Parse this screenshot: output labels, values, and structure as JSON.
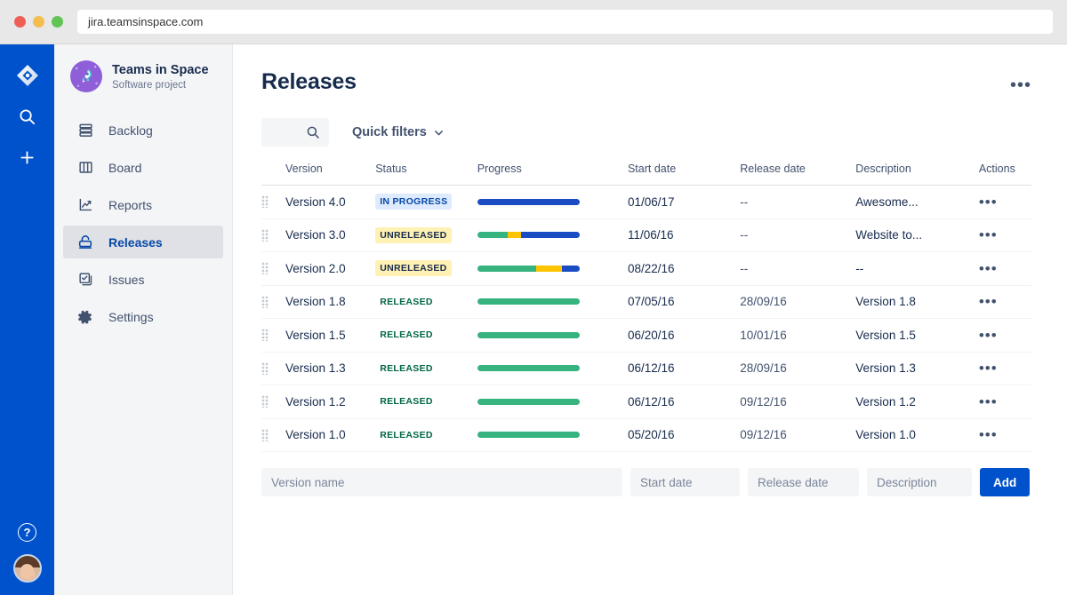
{
  "browser": {
    "url": "jira.teamsinspace.com"
  },
  "rail": {
    "logo_icon": "jira-logo-icon",
    "search_icon": "search-icon",
    "add_icon": "plus-icon",
    "help_label": "?",
    "avatar_label": "user-avatar"
  },
  "sidebar": {
    "project_name": "Teams in Space",
    "project_type": "Software project",
    "project_icon": "rocket-icon",
    "items": [
      {
        "label": "Backlog",
        "icon": "backlog-icon",
        "active": false
      },
      {
        "label": "Board",
        "icon": "board-icon",
        "active": false
      },
      {
        "label": "Reports",
        "icon": "reports-icon",
        "active": false
      },
      {
        "label": "Releases",
        "icon": "releases-icon",
        "active": true
      },
      {
        "label": "Issues",
        "icon": "issues-icon",
        "active": false
      },
      {
        "label": "Settings",
        "icon": "settings-icon",
        "active": false
      }
    ]
  },
  "header": {
    "title": "Releases",
    "more_label": "•••"
  },
  "toolbar": {
    "search_placeholder": "",
    "search_icon": "search-icon",
    "quick_filters_label": "Quick filters",
    "chevron_icon": "chevron-down-icon"
  },
  "table": {
    "columns": [
      "Version",
      "Status",
      "Progress",
      "Start date",
      "Release date",
      "Description",
      "Actions"
    ],
    "rows": [
      {
        "version": "Version 4.0",
        "status": "IN PROGRESS",
        "status_kind": "inprogress",
        "progress": {
          "done": 0,
          "in_progress": 0,
          "todo": 100
        },
        "start_date": "01/06/17",
        "release_date": "--",
        "description": "Awesome...",
        "actions_label": "•••"
      },
      {
        "version": "Version 3.0",
        "status": "UNRELEASED",
        "status_kind": "unreleased",
        "progress": {
          "done": 30,
          "in_progress": 13,
          "todo": 57
        },
        "start_date": "11/06/16",
        "release_date": "--",
        "description": "Website to...",
        "actions_label": "•••"
      },
      {
        "version": "Version 2.0",
        "status": "UNRELEASED",
        "status_kind": "unreleased",
        "progress": {
          "done": 58,
          "in_progress": 25,
          "todo": 17
        },
        "start_date": "08/22/16",
        "release_date": "--",
        "description": "--",
        "actions_label": "•••"
      },
      {
        "version": "Version 1.8",
        "status": "RELEASED",
        "status_kind": "released",
        "progress": {
          "done": 100,
          "in_progress": 0,
          "todo": 0
        },
        "start_date": "07/05/16",
        "release_date": "28/09/16",
        "description": "Version 1.8",
        "actions_label": "•••"
      },
      {
        "version": "Version 1.5",
        "status": "RELEASED",
        "status_kind": "released",
        "progress": {
          "done": 100,
          "in_progress": 0,
          "todo": 0
        },
        "start_date": "06/20/16",
        "release_date": "10/01/16",
        "description": "Version 1.5",
        "actions_label": "•••"
      },
      {
        "version": "Version 1.3",
        "status": "RELEASED",
        "status_kind": "released",
        "progress": {
          "done": 100,
          "in_progress": 0,
          "todo": 0
        },
        "start_date": "06/12/16",
        "release_date": "28/09/16",
        "description": "Version 1.3",
        "actions_label": "•••"
      },
      {
        "version": "Version 1.2",
        "status": "RELEASED",
        "status_kind": "released",
        "progress": {
          "done": 100,
          "in_progress": 0,
          "todo": 0
        },
        "start_date": "06/12/16",
        "release_date": "09/12/16",
        "description": "Version 1.2",
        "actions_label": "•••"
      },
      {
        "version": "Version 1.0",
        "status": "RELEASED",
        "status_kind": "released",
        "progress": {
          "done": 100,
          "in_progress": 0,
          "todo": 0
        },
        "start_date": "05/20/16",
        "release_date": "09/12/16",
        "description": "Version 1.0",
        "actions_label": "•••"
      }
    ]
  },
  "add_form": {
    "version_placeholder": "Version name",
    "version_value": "",
    "start_placeholder": "Start date",
    "start_value": "",
    "release_placeholder": "Release date",
    "release_value": "",
    "description_placeholder": "Description",
    "description_value": "",
    "add_label": "Add"
  },
  "colors": {
    "brand_blue": "#0052CC",
    "progress_done": "#36B37E",
    "progress_in_progress": "#FFC400",
    "progress_todo": "#1B4CC4",
    "sidebar_bg": "#F4F5F7",
    "text_primary": "#172B4D"
  }
}
